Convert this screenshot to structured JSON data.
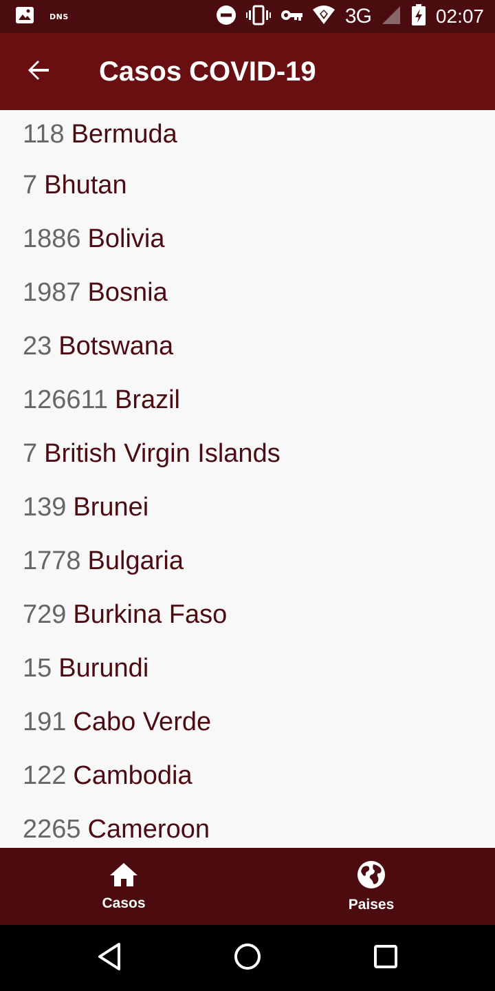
{
  "status_bar": {
    "dns_label": "DNS",
    "network": "3G",
    "time": "02:07"
  },
  "app_bar": {
    "title": "Casos COVID-19"
  },
  "list": [
    {
      "count": "118",
      "country": "Bermuda"
    },
    {
      "count": "7",
      "country": "Bhutan"
    },
    {
      "count": "1886",
      "country": "Bolivia"
    },
    {
      "count": "1987",
      "country": "Bosnia"
    },
    {
      "count": "23",
      "country": "Botswana"
    },
    {
      "count": "126611",
      "country": "Brazil"
    },
    {
      "count": "7",
      "country": "British Virgin Islands"
    },
    {
      "count": "139",
      "country": "Brunei"
    },
    {
      "count": "1778",
      "country": "Bulgaria"
    },
    {
      "count": "729",
      "country": "Burkina Faso"
    },
    {
      "count": "15",
      "country": "Burundi"
    },
    {
      "count": "191",
      "country": "Cabo Verde"
    },
    {
      "count": "122",
      "country": "Cambodia"
    },
    {
      "count": "2265",
      "country": "Cameroon"
    }
  ],
  "bottom_nav": {
    "items": [
      {
        "label": "Casos",
        "icon": "home-icon"
      },
      {
        "label": "Paises",
        "icon": "globe-icon"
      }
    ]
  },
  "colors": {
    "status_bar": "#4a0c0e",
    "app_bar": "#690f12",
    "bottom_nav": "#4c0b0e",
    "country_text": "#4b0b10",
    "count_text": "#666666"
  }
}
